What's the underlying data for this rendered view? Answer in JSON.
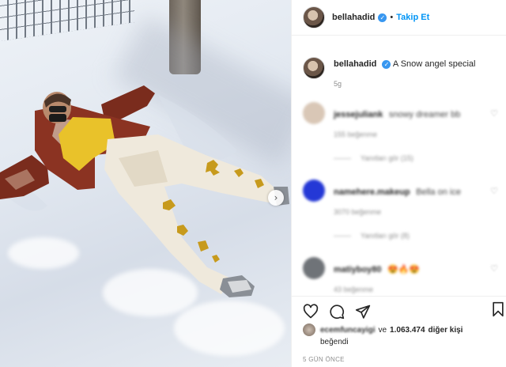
{
  "post": {
    "username": "bellahadid",
    "follow_label": "Takip Et",
    "dot": "•",
    "caption": "A Snow angel special",
    "caption_age": "5g"
  },
  "comments": [
    {
      "username": "jessejuliank",
      "text": "snowy dreamer bb",
      "meta": "155 beğenme",
      "replies": "Yanıtları gör (15)",
      "avatar_color": "#d9c7b6"
    },
    {
      "username": "namehere.makeup",
      "text": "Bella on ice",
      "meta": "3070 beğenme",
      "replies": "Yanıtları gör (8)",
      "avatar_color": "#2438d6"
    },
    {
      "username": "matiyboy80",
      "text": "😍🔥😍",
      "meta": "43 beğenme",
      "avatar_color": "#6f7378"
    }
  ],
  "actions": {
    "like_icon": "heart-icon",
    "comment_icon": "comment-icon",
    "share_icon": "share-icon",
    "save_icon": "bookmark-icon"
  },
  "likes": {
    "liker": "ecemfuncayigi",
    "and": "ve",
    "count": "1.063.474",
    "rest": "diğer kişi",
    "liked": "beğendi"
  },
  "timestamp": "5 GÜN ÖNCE",
  "colors": {
    "link": "#0095f6",
    "verified": "#3897f0",
    "muted": "#8e8e8e"
  }
}
